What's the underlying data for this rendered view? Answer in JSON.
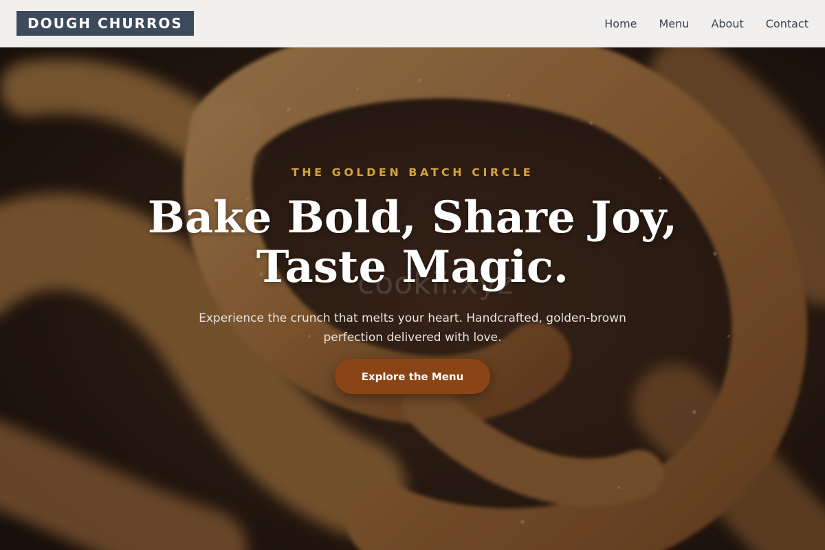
{
  "header": {
    "brand": "DOUGH CHURROS",
    "nav": [
      "Home",
      "Menu",
      "About",
      "Contact"
    ]
  },
  "hero": {
    "eyebrow": "THE GOLDEN BATCH CIRCLE",
    "headline_line1": "Bake Bold, Share Joy,",
    "headline_line2": "Taste Magic.",
    "subtext": "Experience the crunch that melts your heart. Handcrafted, golden-brown perfection delivered with love.",
    "cta_label": "Explore the Menu",
    "watermark": "cookii.xyz",
    "background_image": "churro-closeup-photo"
  },
  "colors": {
    "header_bg": "#f1f0ee",
    "logo_bg": "#3d4a5b",
    "accent_gold": "#d4a33b",
    "cta_bg": "#8a4516"
  }
}
